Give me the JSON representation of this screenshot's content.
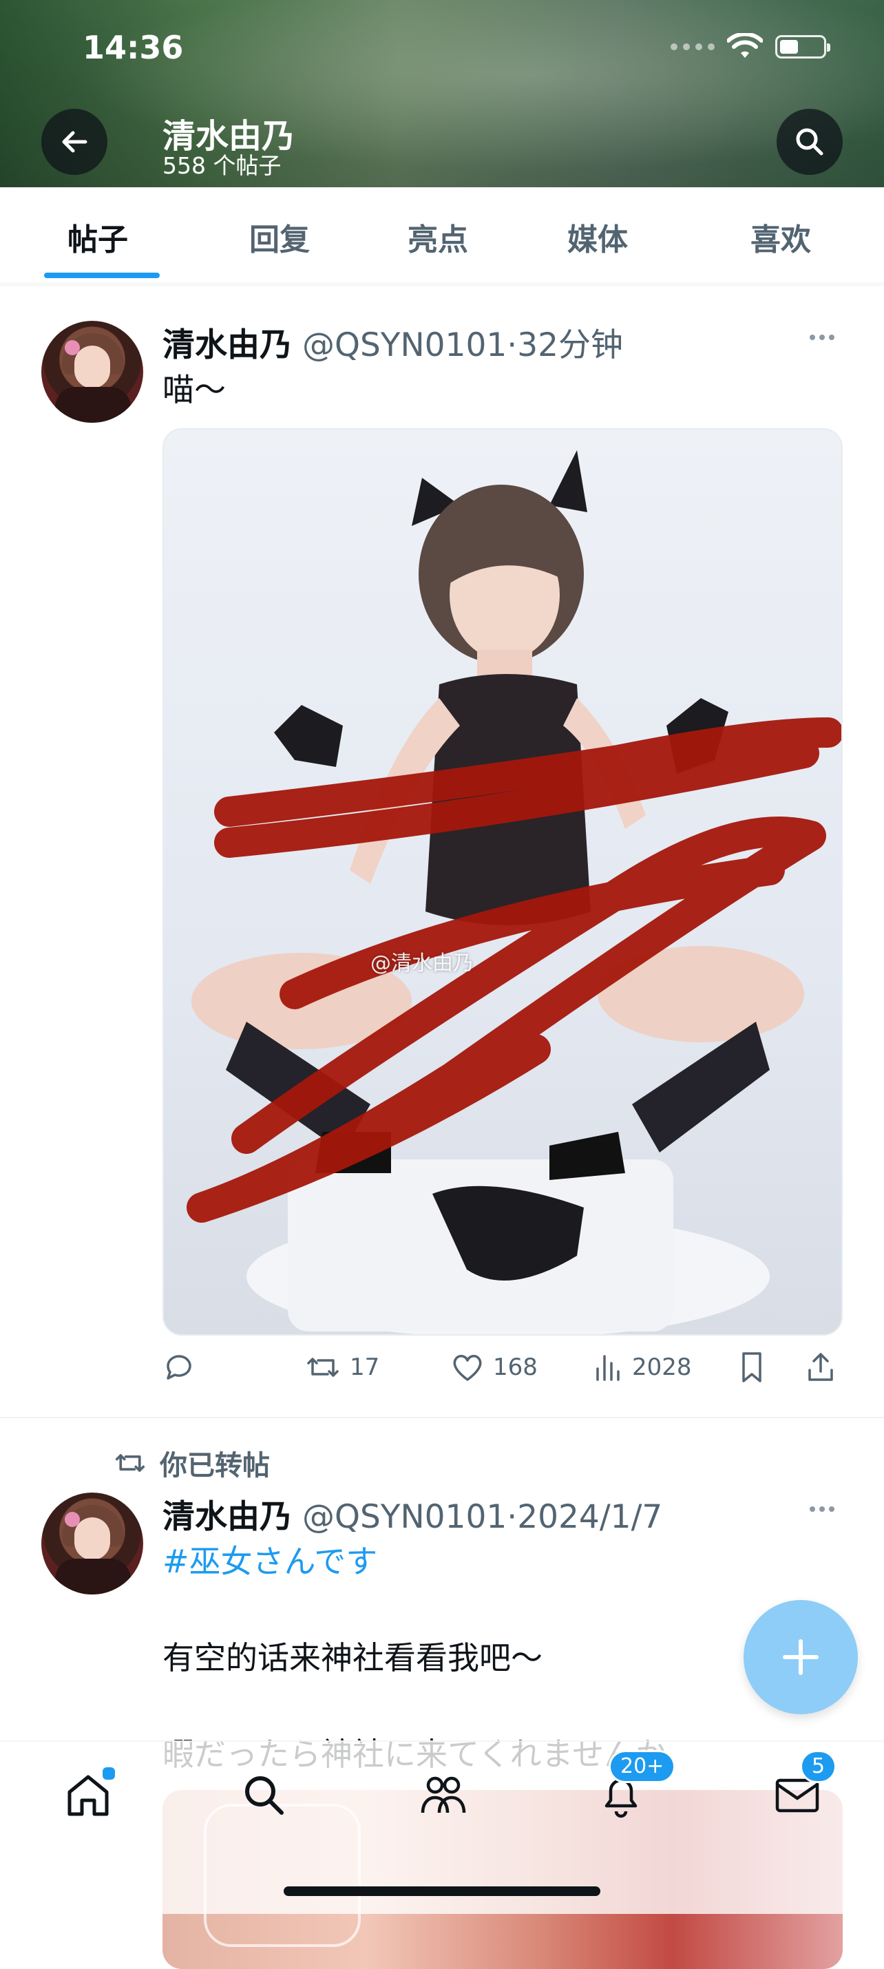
{
  "status_bar": {
    "time": "14:36"
  },
  "header": {
    "name": "清水由乃",
    "post_count": "558 个帖子"
  },
  "tabs": [
    {
      "label": "帖子",
      "active": true
    },
    {
      "label": "回复",
      "active": false
    },
    {
      "label": "亮点",
      "active": false
    },
    {
      "label": "媒体",
      "active": false
    },
    {
      "label": "喜欢",
      "active": false
    }
  ],
  "posts": [
    {
      "name": "清水由乃",
      "handle": "@QSYN0101",
      "sep": "·",
      "time": "32分钟",
      "text": "喵～",
      "media_watermark": "@清水由乃",
      "stats": {
        "replies": "",
        "reposts": "17",
        "likes": "168",
        "views": "2028"
      }
    },
    {
      "retweet_note": "你已转帖",
      "name": "清水由乃",
      "handle": "@QSYN0101",
      "sep": "·",
      "time": "2024/1/7",
      "hashtag": "#巫女さんです",
      "line1": "有空的话来神社看看我吧～",
      "line2": "暇だったら神社に来てくれませんか"
    }
  ],
  "bottom_nav": {
    "notifications_badge": "20+",
    "messages_badge": "5"
  },
  "colors": {
    "accent": "#1d9bf0",
    "text": "#0f1419",
    "secondary": "#536471",
    "fab": "#8ecdf7"
  },
  "icons": [
    "back-arrow-icon",
    "search-icon",
    "more-icon",
    "reply-icon",
    "repost-icon",
    "like-icon",
    "views-icon",
    "bookmark-icon",
    "share-icon",
    "plus-icon",
    "home-icon",
    "people-icon",
    "bell-icon",
    "mail-icon"
  ]
}
